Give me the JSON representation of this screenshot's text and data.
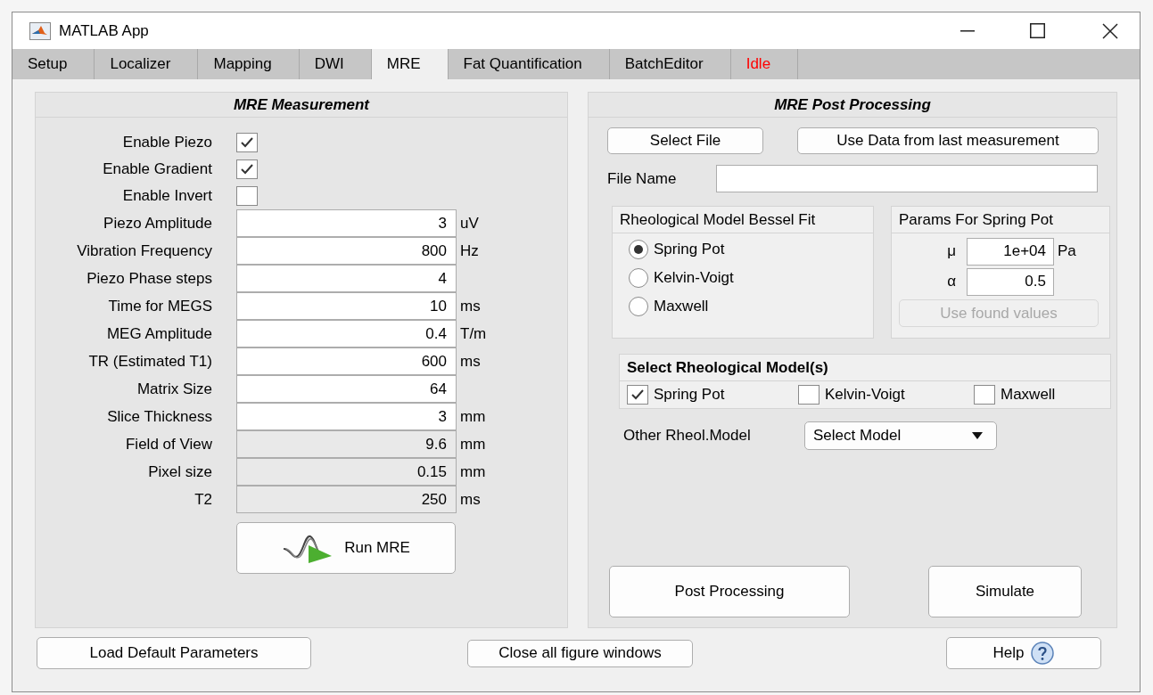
{
  "window": {
    "title": "MATLAB App"
  },
  "tabs": [
    {
      "label": "Setup",
      "selected": false,
      "color": "#000000"
    },
    {
      "label": "Localizer",
      "selected": false,
      "color": "#000000"
    },
    {
      "label": "Mapping",
      "selected": false,
      "color": "#000000"
    },
    {
      "label": "DWI",
      "selected": false,
      "color": "#000000"
    },
    {
      "label": "MRE",
      "selected": true,
      "color": "#000000"
    },
    {
      "label": "Fat Quantification",
      "selected": false,
      "color": "#000000"
    },
    {
      "label": "BatchEditor",
      "selected": false,
      "color": "#000000"
    },
    {
      "label": "Idle",
      "selected": false,
      "color": "#ff0000"
    }
  ],
  "measurement": {
    "title": "MRE Measurement",
    "rows": [
      {
        "kind": "checkbox",
        "label": "Enable Piezo",
        "checked": true
      },
      {
        "kind": "checkbox",
        "label": "Enable Gradient",
        "checked": true
      },
      {
        "kind": "checkbox",
        "label": "Enable Invert",
        "checked": false
      },
      {
        "kind": "field",
        "label": "Piezo Amplitude",
        "value": "3",
        "unit": "uV",
        "editable": true
      },
      {
        "kind": "field",
        "label": "Vibration Frequency",
        "value": "800",
        "unit": "Hz",
        "editable": true
      },
      {
        "kind": "field",
        "label": "Piezo Phase steps",
        "value": "4",
        "editable": true
      },
      {
        "kind": "field",
        "label": "Time for MEGS",
        "value": "10",
        "unit": "ms",
        "editable": true
      },
      {
        "kind": "field",
        "label": "MEG Amplitude",
        "value": "0.4",
        "unit": "T/m",
        "editable": true
      },
      {
        "kind": "field",
        "label": "TR (Estimated T1)",
        "value": "600",
        "unit": "ms",
        "editable": true
      },
      {
        "kind": "field",
        "label": "Matrix Size",
        "value": "64",
        "editable": true
      },
      {
        "kind": "field",
        "label": "Slice Thickness",
        "value": "3",
        "unit": "mm",
        "editable": true
      },
      {
        "kind": "field",
        "label": "Field of View",
        "value": "9.6",
        "unit": "mm",
        "editable": false
      },
      {
        "kind": "field",
        "label": "Pixel size",
        "value": "0.15",
        "unit": "mm",
        "editable": false
      },
      {
        "kind": "field",
        "label": "T2",
        "value": "250",
        "unit": "ms",
        "editable": false
      }
    ],
    "run_button": "Run MRE"
  },
  "post_processing": {
    "title": "MRE Post Processing",
    "select_file_button": "Select File",
    "use_data_button": "Use Data from last measurement",
    "file_name": {
      "label": "File Name"
    },
    "bessel_fit": {
      "title": "Rheological Model Bessel Fit",
      "options": [
        {
          "label": "Spring Pot",
          "selected": true
        },
        {
          "label": "Kelvin-Voigt",
          "selected": false
        },
        {
          "label": "Maxwell",
          "selected": false
        }
      ]
    },
    "params": {
      "title": "Params For Spring Pot",
      "fields": [
        {
          "label": "μ",
          "value": "1e+04",
          "unit": "Pa"
        },
        {
          "label": "α",
          "value": "0.5"
        }
      ],
      "use_found_values_button": {
        "label": "Use found values",
        "disabled": true
      }
    },
    "select_models": {
      "title": "Select Rheological Model(s)",
      "options": [
        {
          "label": "Spring Pot",
          "checked": true
        },
        {
          "label": "Kelvin-Voigt",
          "checked": false
        },
        {
          "label": "Maxwell",
          "checked": false
        }
      ]
    },
    "other_model": {
      "label": "Other Rheol.Model",
      "value": "Select Model"
    },
    "post_processing_button": "Post Processing",
    "simulate_button": "Simulate"
  },
  "footer": {
    "load_defaults_button": "Load Default Parameters",
    "close_figures_button": "Close all figure windows",
    "help_button": "Help"
  }
}
